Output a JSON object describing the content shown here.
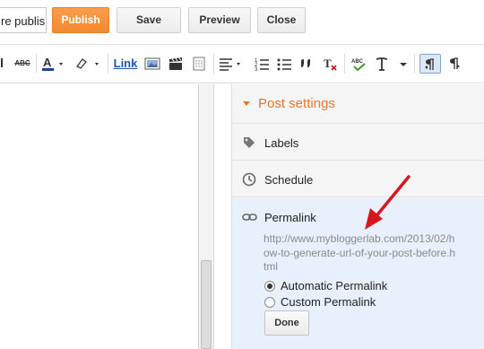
{
  "header": {
    "title_value": "re publis",
    "publish_label": "Publish",
    "save_label": "Save",
    "preview_label": "Preview",
    "close_label": "Close"
  },
  "toolbar": {
    "abc_label": "ABC",
    "link_label": "Link",
    "icons": [
      "font-size-icon",
      "strikethrough-icon",
      "text-color-icon",
      "highlight-icon",
      "link-button",
      "image-icon",
      "video-icon",
      "jump-break-icon",
      "align-icon",
      "numbered-list-icon",
      "bullet-list-icon",
      "quote-icon",
      "clear-format-icon",
      "spellcheck-icon",
      "input-tools-icon",
      "ltr-icon",
      "rtl-icon"
    ]
  },
  "post_settings": {
    "title": "Post settings",
    "labels": "Labels",
    "schedule": "Schedule",
    "permalink": {
      "label": "Permalink",
      "url": "http://www.mybloggerlab.com/2013/02/how-to-generate-url-of-your-post-before.html",
      "options": [
        {
          "label": "Automatic Permalink",
          "selected": true
        },
        {
          "label": "Custom Permalink",
          "selected": false
        }
      ],
      "done_label": "Done"
    }
  },
  "colors": {
    "accent_orange": "#e8762c",
    "publish_bg": "#f38a2e",
    "link_blue": "#1f55b2",
    "panel_highlight": "#e8f0fb",
    "arrow_red": "#d7171d"
  }
}
